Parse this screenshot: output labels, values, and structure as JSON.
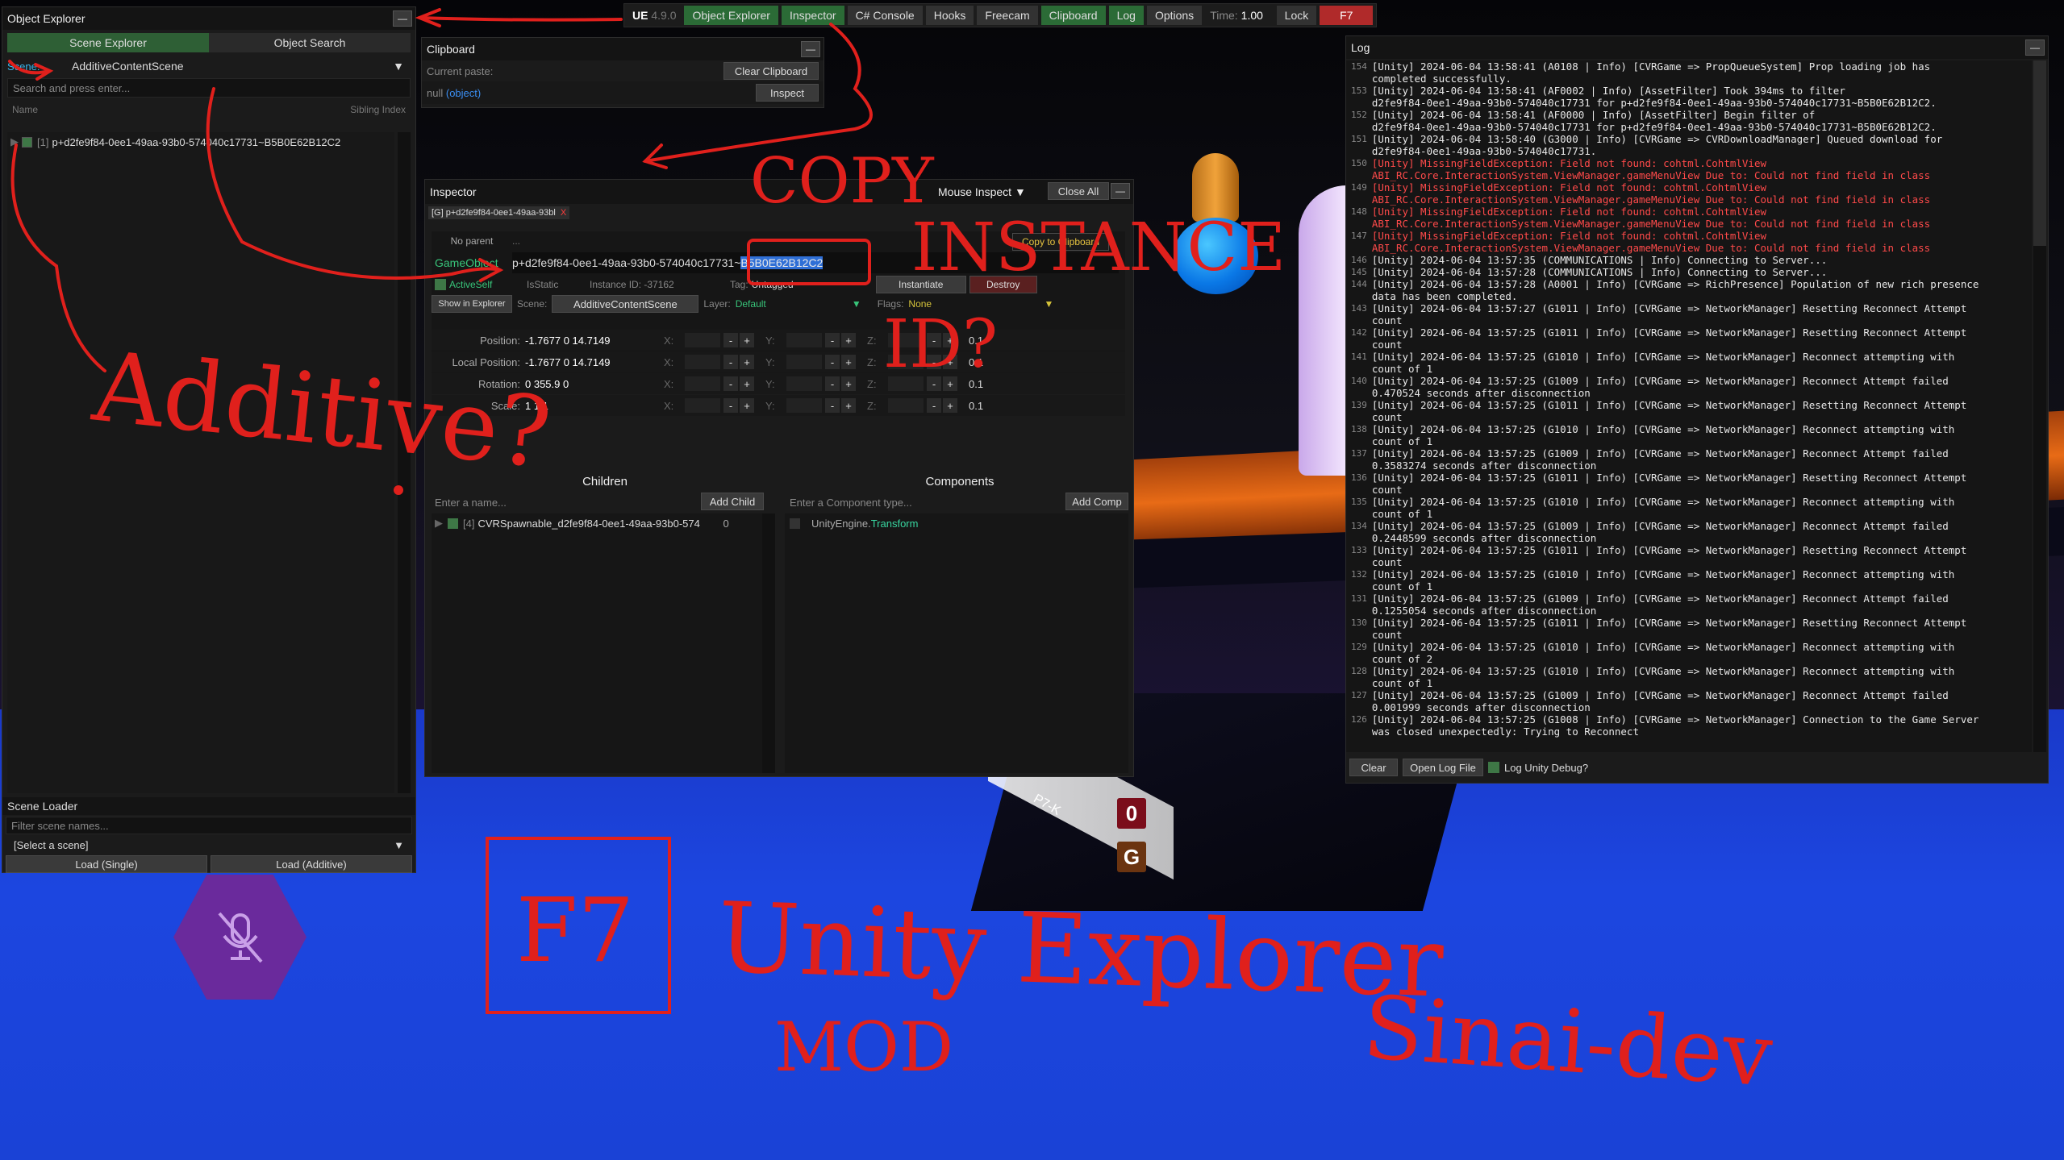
{
  "topbar": {
    "version_name": "UE",
    "version_num": "4.9.0",
    "buttons": [
      "Object Explorer",
      "Inspector",
      "C# Console",
      "Hooks",
      "Freecam",
      "Clipboard",
      "Log",
      "Options"
    ],
    "time_label": "Time:",
    "time_value": "1.00",
    "lock_label": "Lock",
    "close_key": "F7"
  },
  "object_explorer": {
    "title": "Object Explorer",
    "tab_scene": "Scene Explorer",
    "tab_search": "Object Search",
    "scene_label": "Scene:",
    "scene_value": "AdditiveContentScene",
    "search_placeholder": "Search and press enter...",
    "col_name": "Name",
    "col_sibling": "Sibling Index",
    "items": [
      {
        "index": "[1]",
        "name": "p+d2fe9f84-0ee1-49aa-93b0-574040c17731~B5B0E62B12C2"
      }
    ]
  },
  "scene_loader": {
    "title": "Scene Loader",
    "filter_placeholder": "Filter scene names...",
    "select_value": "[Select a scene]",
    "load_single": "Load (Single)",
    "load_additive": "Load (Additive)"
  },
  "clipboard": {
    "title": "Clipboard",
    "current_label": "Current paste:",
    "clear_button": "Clear Clipboard",
    "value_null": "null",
    "value_type": "(object)",
    "inspect_button": "Inspect"
  },
  "inspector": {
    "title": "Inspector",
    "mouse_inspect": "Mouse Inspect",
    "close_all": "Close All",
    "tab_label": "[G] p+d2fe9f84-0ee1-49aa-93bl",
    "tab_close": "X",
    "no_parent": "No parent",
    "parent_value": "...",
    "copy_clipboard": "Copy to Clipboard",
    "go_label": "GameObject",
    "go_name_plain": "p+d2fe9f84-0ee1-49aa-93b0-574040c17731~",
    "go_name_selected": "B5B0E62B12C2",
    "active_self": "ActiveSelf",
    "is_static": "IsStatic",
    "instance_id": "Instance ID: -37162",
    "tag_label": "Tag:",
    "tag_value": "Untagged",
    "instantiate": "Instantiate",
    "destroy": "Destroy",
    "show_in_explorer": "Show in Explorer",
    "scene_label": "Scene:",
    "scene_value": "AdditiveContentScene",
    "layer_label": "Layer:",
    "layer_value": "Default",
    "flags_label": "Flags:",
    "flags_value": "None",
    "transform": [
      {
        "label": "Position:",
        "value": "-1.7677 0 14.7149"
      },
      {
        "label": "Local Position:",
        "value": "-1.7677 0 14.7149"
      },
      {
        "label": "Rotation:",
        "value": "0 355.9 0"
      },
      {
        "label": "Scale:",
        "value": "1 1 1"
      }
    ],
    "axis_x": "X:",
    "axis_y": "Y:",
    "axis_z": "Z:",
    "step": "0.1",
    "minus": "-",
    "plus": "+",
    "children_title": "Children",
    "children_placeholder": "Enter a name...",
    "add_child": "Add Child",
    "children": [
      {
        "index": "[4]",
        "name": "CVRSpawnable_d2fe9f84-0ee1-49aa-93b0-574",
        "count": "0"
      }
    ],
    "components_title": "Components",
    "components_placeholder": "Enter a Component type...",
    "add_comp": "Add Comp",
    "components": [
      {
        "ns": "UnityEngine.",
        "type": "Transform"
      }
    ]
  },
  "log": {
    "title": "Log",
    "clear": "Clear",
    "open_log_file": "Open Log File",
    "log_unity_debug": "Log Unity Debug?",
    "rows": [
      {
        "n": "154",
        "err": false,
        "text": "[Unity] 2024-06-04 13:58:41 (A0108 | Info) [CVRGame => PropQueueSystem] Prop loading job has\ncompleted successfully."
      },
      {
        "n": "153",
        "err": false,
        "text": "[Unity] 2024-06-04 13:58:41 (AF0002 | Info) [AssetFilter] Took 394ms to filter\nd2fe9f84-0ee1-49aa-93b0-574040c17731 for p+d2fe9f84-0ee1-49aa-93b0-574040c17731~B5B0E62B12C2."
      },
      {
        "n": "152",
        "err": false,
        "text": "[Unity] 2024-06-04 13:58:41 (AF0000 | Info) [AssetFilter] Begin filter of\nd2fe9f84-0ee1-49aa-93b0-574040c17731 for p+d2fe9f84-0ee1-49aa-93b0-574040c17731~B5B0E62B12C2."
      },
      {
        "n": "151",
        "err": false,
        "text": "[Unity] 2024-06-04 13:58:40 (G3000 | Info) [CVRGame => CVRDownloadManager] Queued download for\nd2fe9f84-0ee1-49aa-93b0-574040c17731."
      },
      {
        "n": "150",
        "err": true,
        "text": "[Unity] MissingFieldException: Field not found: cohtml.CohtmlView\nABI_RC.Core.InteractionSystem.ViewManager.gameMenuView Due to: Could not find field in class"
      },
      {
        "n": "149",
        "err": true,
        "text": "[Unity] MissingFieldException: Field not found: cohtml.CohtmlView\nABI_RC.Core.InteractionSystem.ViewManager.gameMenuView Due to: Could not find field in class"
      },
      {
        "n": "148",
        "err": true,
        "text": "[Unity] MissingFieldException: Field not found: cohtml.CohtmlView\nABI_RC.Core.InteractionSystem.ViewManager.gameMenuView Due to: Could not find field in class"
      },
      {
        "n": "147",
        "err": true,
        "text": "[Unity] MissingFieldException: Field not found: cohtml.CohtmlView\nABI_RC.Core.InteractionSystem.ViewManager.gameMenuView Due to: Could not find field in class"
      },
      {
        "n": "146",
        "err": false,
        "text": "[Unity] 2024-06-04 13:57:35 (COMMUNICATIONS | Info) Connecting to Server..."
      },
      {
        "n": "145",
        "err": false,
        "text": "[Unity] 2024-06-04 13:57:28 (COMMUNICATIONS | Info) Connecting to Server..."
      },
      {
        "n": "144",
        "err": false,
        "text": "[Unity] 2024-06-04 13:57:28 (A0001 | Info) [CVRGame => RichPresence] Population of new rich presence\ndata has been completed."
      },
      {
        "n": "143",
        "err": false,
        "text": "[Unity] 2024-06-04 13:57:27 (G1011 | Info) [CVRGame => NetworkManager] Resetting Reconnect Attempt\ncount"
      },
      {
        "n": "142",
        "err": false,
        "text": "[Unity] 2024-06-04 13:57:25 (G1011 | Info) [CVRGame => NetworkManager] Resetting Reconnect Attempt\ncount"
      },
      {
        "n": "141",
        "err": false,
        "text": "[Unity] 2024-06-04 13:57:25 (G1010 | Info) [CVRGame => NetworkManager] Reconnect attempting with\ncount of 1"
      },
      {
        "n": "140",
        "err": false,
        "text": "[Unity] 2024-06-04 13:57:25 (G1009 | Info) [CVRGame => NetworkManager] Reconnect Attempt failed\n0.470524 seconds after disconnection"
      },
      {
        "n": "139",
        "err": false,
        "text": "[Unity] 2024-06-04 13:57:25 (G1011 | Info) [CVRGame => NetworkManager] Resetting Reconnect Attempt\ncount"
      },
      {
        "n": "138",
        "err": false,
        "text": "[Unity] 2024-06-04 13:57:25 (G1010 | Info) [CVRGame => NetworkManager] Reconnect attempting with\ncount of 1"
      },
      {
        "n": "137",
        "err": false,
        "text": "[Unity] 2024-06-04 13:57:25 (G1009 | Info) [CVRGame => NetworkManager] Reconnect Attempt failed\n0.3583274 seconds after disconnection"
      },
      {
        "n": "136",
        "err": false,
        "text": "[Unity] 2024-06-04 13:57:25 (G1011 | Info) [CVRGame => NetworkManager] Resetting Reconnect Attempt\ncount"
      },
      {
        "n": "135",
        "err": false,
        "text": "[Unity] 2024-06-04 13:57:25 (G1010 | Info) [CVRGame => NetworkManager] Reconnect attempting with\ncount of 1"
      },
      {
        "n": "134",
        "err": false,
        "text": "[Unity] 2024-06-04 13:57:25 (G1009 | Info) [CVRGame => NetworkManager] Reconnect Attempt failed\n0.2448599 seconds after disconnection"
      },
      {
        "n": "133",
        "err": false,
        "text": "[Unity] 2024-06-04 13:57:25 (G1011 | Info) [CVRGame => NetworkManager] Resetting Reconnect Attempt\ncount"
      },
      {
        "n": "132",
        "err": false,
        "text": "[Unity] 2024-06-04 13:57:25 (G1010 | Info) [CVRGame => NetworkManager] Reconnect attempting with\ncount of 1"
      },
      {
        "n": "131",
        "err": false,
        "text": "[Unity] 2024-06-04 13:57:25 (G1009 | Info) [CVRGame => NetworkManager] Reconnect Attempt failed\n0.1255054 seconds after disconnection"
      },
      {
        "n": "130",
        "err": false,
        "text": "[Unity] 2024-06-04 13:57:25 (G1011 | Info) [CVRGame => NetworkManager] Resetting Reconnect Attempt\ncount"
      },
      {
        "n": "129",
        "err": false,
        "text": "[Unity] 2024-06-04 13:57:25 (G1010 | Info) [CVRGame => NetworkManager] Reconnect attempting with\ncount of 2"
      },
      {
        "n": "128",
        "err": false,
        "text": "[Unity] 2024-06-04 13:57:25 (G1010 | Info) [CVRGame => NetworkManager] Reconnect attempting with\ncount of 1"
      },
      {
        "n": "127",
        "err": false,
        "text": "[Unity] 2024-06-04 13:57:25 (G1009 | Info) [CVRGame => NetworkManager] Reconnect Attempt failed\n0.001999 seconds after disconnection"
      },
      {
        "n": "126",
        "err": false,
        "text": "[Unity] 2024-06-04 13:57:25 (G1008 | Info) [CVRGame => NetworkManager] Connection to the Game Server\nwas closed unexpectedly: Trying to Reconnect"
      }
    ]
  },
  "scene_signs": {
    "label": "P7-K",
    "sign1": "0",
    "sign2": "G"
  },
  "annotations": {
    "copy": "COPY",
    "instance": "INSTANCE",
    "id": "ID?",
    "additive": "Additive?",
    "f7": "F7",
    "unity_explorer": "Unity Explorer",
    "mod": "MOD",
    "sinai": "Sinai-dev"
  },
  "colors": {
    "accent_green": "#2e5f35",
    "error_red": "#ff4a4a",
    "ink_red": "#e0201c",
    "highlight_blue": "#2f6fd6",
    "link_blue": "#3a8df0",
    "component_green": "#38d6a0"
  },
  "icons": [
    "expand-arrow-icon",
    "dropdown-arrow-icon",
    "minimize-icon",
    "mute-microphone-icon"
  ]
}
